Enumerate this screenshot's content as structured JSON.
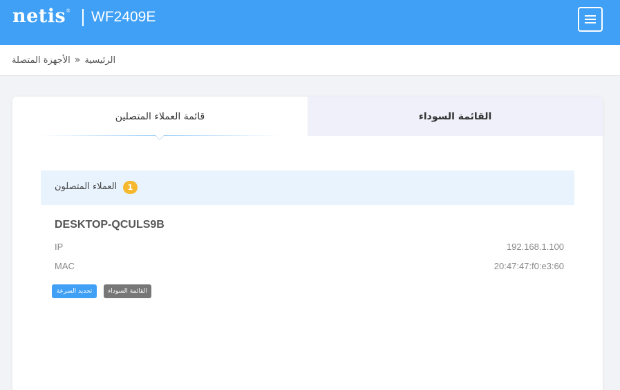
{
  "header": {
    "logo": "netis",
    "logo_mark": "®",
    "model": "WF2409E",
    "menu_icon": "hamburger-icon"
  },
  "breadcrumb": {
    "home": "الرئيسية",
    "separator": "«",
    "current": "الأجهزة المتصلة"
  },
  "tabs": [
    {
      "label": "قائمة العملاء المتصلين",
      "active": true
    },
    {
      "label": "القائمة السوداء",
      "active": false
    }
  ],
  "section": {
    "title": "العملاء المتصلون",
    "count": "1"
  },
  "device": {
    "name": "DESKTOP-QCULS9B",
    "ip_label": "IP",
    "ip": "192.168.1.100",
    "mac_label": "MAC",
    "mac": "20:47:47:f0:e3:60",
    "speed_limit_button": "تحديد السرعة",
    "blacklist_button": "القائمة السوداء"
  },
  "colors": {
    "header_bg": "#3fa0f5",
    "badge": "#f5b82e",
    "speed_button": "#3fa0f5",
    "blacklist_button": "#777777",
    "section_bg": "#e9f3fd",
    "inactive_tab_bg": "#f0f0fb"
  }
}
